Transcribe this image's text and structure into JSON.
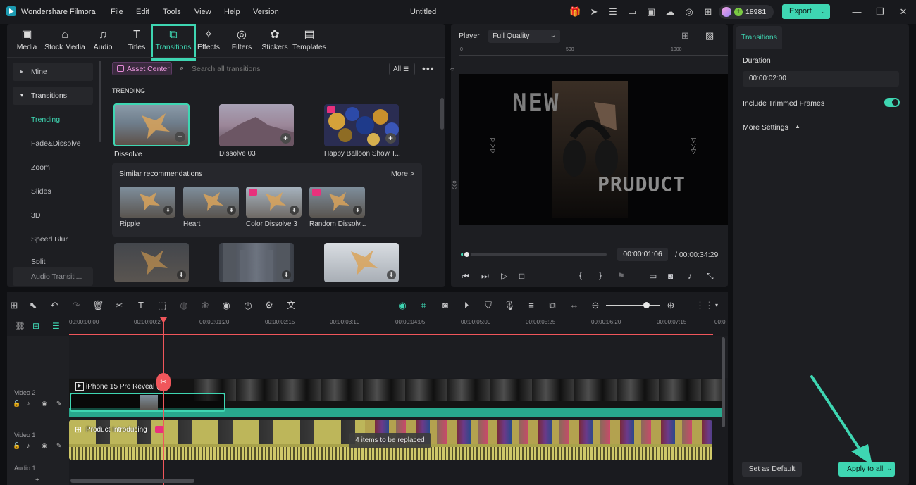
{
  "app": {
    "name": "Wondershare Filmora",
    "doc_title": "Untitled",
    "credits": "18981",
    "export_label": "Export"
  },
  "menu": [
    "File",
    "Edit",
    "Tools",
    "View",
    "Help",
    "Version"
  ],
  "media_tabs": [
    {
      "label": "Media",
      "icon": "media-icon"
    },
    {
      "label": "Stock Media",
      "icon": "stock-media-icon"
    },
    {
      "label": "Audio",
      "icon": "audio-icon"
    },
    {
      "label": "Titles",
      "icon": "titles-icon"
    },
    {
      "label": "Transitions",
      "icon": "transitions-icon",
      "active": true
    },
    {
      "label": "Effects",
      "icon": "effects-icon"
    },
    {
      "label": "Filters",
      "icon": "filters-icon"
    },
    {
      "label": "Stickers",
      "icon": "stickers-icon"
    },
    {
      "label": "Templates",
      "icon": "templates-icon"
    }
  ],
  "sidebar": [
    {
      "label": "Mine",
      "kind": "group"
    },
    {
      "label": "Transitions",
      "kind": "group-open"
    },
    {
      "label": "Trending",
      "kind": "item",
      "active": true
    },
    {
      "label": "Fade&Dissolve",
      "kind": "item"
    },
    {
      "label": "Zoom",
      "kind": "item"
    },
    {
      "label": "Slides",
      "kind": "item"
    },
    {
      "label": "3D",
      "kind": "item"
    },
    {
      "label": "Speed Blur",
      "kind": "item"
    },
    {
      "label": "Split",
      "kind": "item"
    },
    {
      "label": "Audio Transiti...",
      "kind": "item"
    }
  ],
  "browser": {
    "asset_center": "Asset Center",
    "search_placeholder": "Search all transitions",
    "filter": "All",
    "section": "TRENDING",
    "trending": [
      {
        "label": "Dissolve"
      },
      {
        "label": "Dissolve 03"
      },
      {
        "label": "Happy Balloon Show T..."
      }
    ],
    "similar_title": "Similar recommendations",
    "similar_more": "More >",
    "similar": [
      {
        "label": "Ripple"
      },
      {
        "label": "Heart"
      },
      {
        "label": "Color Dissolve 3"
      },
      {
        "label": "Random Dissolv..."
      }
    ]
  },
  "player": {
    "label": "Player",
    "quality": "Full Quality",
    "ruler": [
      "0",
      "500",
      "1000"
    ],
    "ruler_v": [
      "0",
      "500"
    ],
    "overlay_top": "NEW",
    "overlay_bottom": "PRUDUCT",
    "current_time": "00:00:01:06",
    "total_time": "/ 00:00:34:29",
    "progress": 0.04
  },
  "right_panel": {
    "tab": "Transitions",
    "duration_label": "Duration",
    "duration_value": "00:00:02:00",
    "include_trimmed": "Include Trimmed Frames",
    "include_trimmed_on": true,
    "more_settings": "More Settings",
    "set_default": "Set as Default",
    "apply_all": "Apply to all"
  },
  "timeline": {
    "ruler": [
      "00:00:00:00",
      "00:00:00:2",
      "00:00:01:20",
      "00:00:02:15",
      "00:00:03:10",
      "00:00:04:05",
      "00:00:05:00",
      "00:00:05:25",
      "00:00:06:20",
      "00:00:07:15",
      "00:0"
    ],
    "tracks": [
      {
        "label": "Video 2",
        "clip": "iPhone 15 Pro Reveal (1"
      },
      {
        "label": "Video 1",
        "clip": "Product Introducing"
      },
      {
        "label": "Audio 1"
      }
    ],
    "replace_tooltip": "4 items to be replaced",
    "zoom": 0.75
  },
  "colors": {
    "accent": "#3ed6b2",
    "playhead": "#f0565b",
    "gem": "#e8317c",
    "audio": "#cfc56a"
  }
}
